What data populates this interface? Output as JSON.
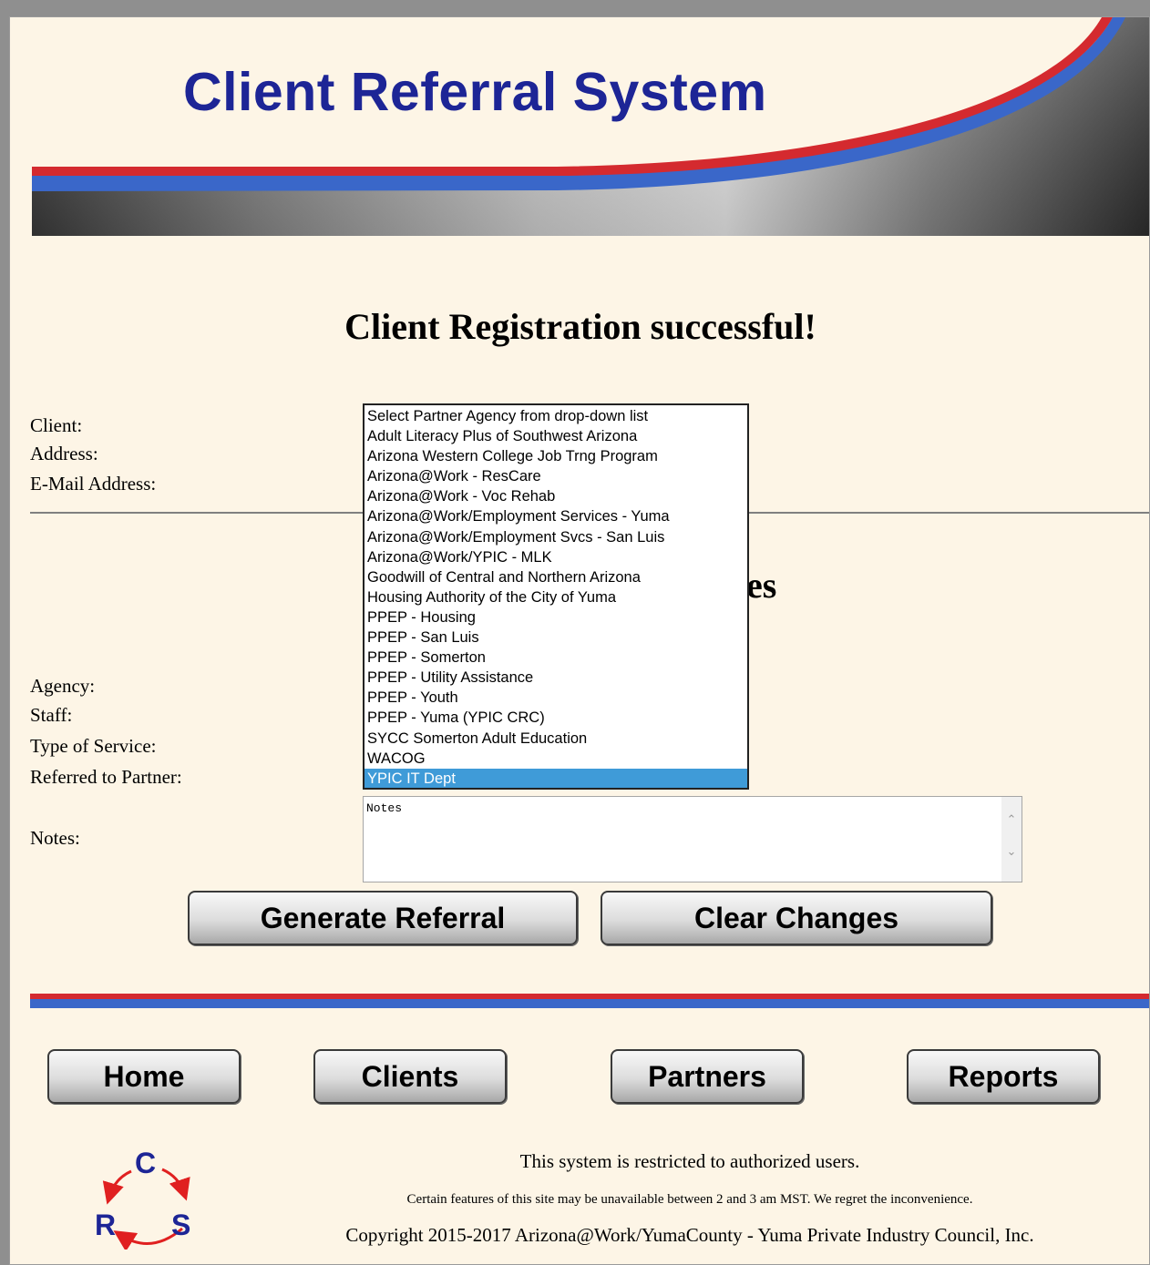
{
  "header": {
    "title": "Client Referral System"
  },
  "status": {
    "message": "Client Registration successful!"
  },
  "client_info": {
    "client_label": "Client:",
    "address_label": "Address:",
    "email_label": "E-Mail Address:"
  },
  "referral": {
    "partial_heading": "es",
    "agency_label": "Agency:",
    "staff_label": "Staff:",
    "service_label": "Type of Service:",
    "partner_label": "Referred to Partner:",
    "notes_label": "Notes:",
    "notes_value": "Notes",
    "partner_options": [
      "Select Partner Agency from drop-down list",
      "Adult Literacy Plus of Southwest Arizona",
      "Arizona Western College Job Trng Program",
      "Arizona@Work - ResCare",
      "Arizona@Work - Voc Rehab",
      "Arizona@Work/Employment Services - Yuma",
      "Arizona@Work/Employment Svcs - San Luis",
      "Arizona@Work/YPIC - MLK",
      "Goodwill of Central and Northern Arizona",
      "Housing Authority of the City of Yuma",
      "PPEP - Housing",
      "PPEP - San Luis",
      "PPEP - Somerton",
      "PPEP - Utility Assistance",
      "PPEP - Youth",
      "PPEP - Yuma (YPIC CRC)",
      "SYCC Somerton Adult Education",
      "WACOG",
      "YPIC IT Dept"
    ],
    "selected_partner": "YPIC IT Dept",
    "generate_button": "Generate Referral",
    "clear_button": "Clear Changes"
  },
  "nav": {
    "home": "Home",
    "clients": "Clients",
    "partners": "Partners",
    "reports": "Reports"
  },
  "footer": {
    "restricted": "This system is restricted to authorized users.",
    "maintenance": "Certain features of this site may be unavailable between 2 and 3 am MST. We regret the inconvenience.",
    "copyright": "Copyright 2015-2017 Arizona@Work/YumaCounty - Yuma Private Industry Council, Inc."
  },
  "logo": {
    "letters": [
      "C",
      "R",
      "S"
    ]
  },
  "colors": {
    "title_blue": "#1d2596",
    "stripe_red": "#d42a2f",
    "stripe_blue": "#3a67c9",
    "selected_option": "#3f9bd8",
    "page_background": "#fdf5e6"
  },
  "icons": {
    "scroll_up": "chevron-up-icon",
    "scroll_down": "chevron-down-icon"
  }
}
